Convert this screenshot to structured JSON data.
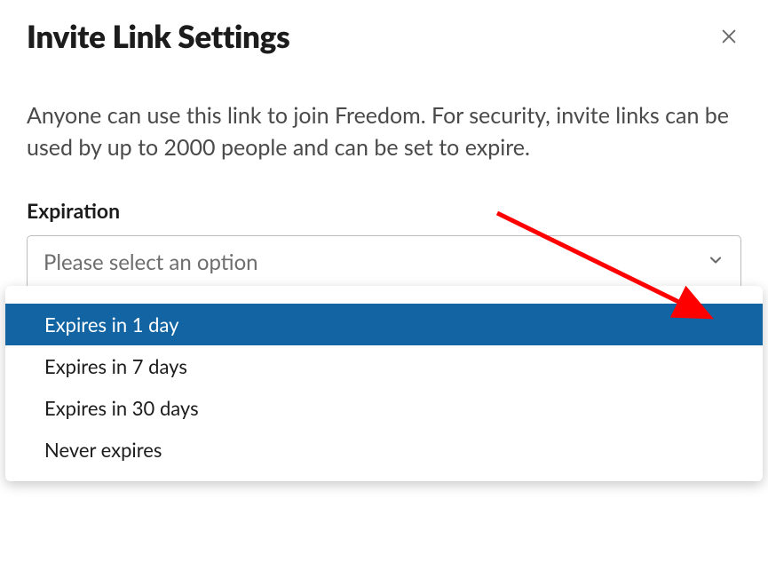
{
  "header": {
    "title": "Invite Link Settings"
  },
  "description": "Anyone can use this link to join Freedom. For security, invite links can be used by up to 2000 people and can be set to expire.",
  "expiration": {
    "label": "Expiration",
    "placeholder": "Please select an option",
    "options": [
      "Expires in 1 day",
      "Expires in 7 days",
      "Expires in 30 days",
      "Never expires"
    ],
    "highlighted_index": 0
  },
  "annotation": {
    "arrow_color": "#ff0000"
  }
}
